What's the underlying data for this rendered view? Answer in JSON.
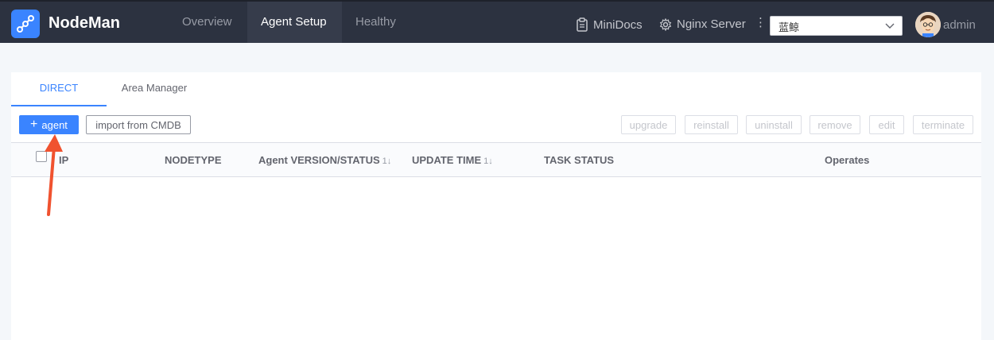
{
  "app": {
    "name": "NodeMan"
  },
  "nav": {
    "items": [
      {
        "label": "Overview"
      },
      {
        "label": "Agent Setup",
        "active": true
      },
      {
        "label": "Healthy"
      }
    ]
  },
  "header": {
    "minidocs": "MiniDocs",
    "server": "Nginx Server",
    "business_select": "蓝鲸",
    "user": "admin"
  },
  "tabs": [
    {
      "label": "DIRECT",
      "active": true
    },
    {
      "label": "Area Manager"
    }
  ],
  "toolbar": {
    "add_agent": "agent",
    "import_cmdb": "import from CMDB",
    "upgrade": "upgrade",
    "reinstall": "reinstall",
    "uninstall": "uninstall",
    "remove": "remove",
    "edit": "edit",
    "terminate": "terminate"
  },
  "table": {
    "columns": [
      "IP",
      "NODETYPE",
      "Agent VERSION/STATUS",
      "UPDATE TIME",
      "TASK STATUS",
      "Operates"
    ],
    "sort_glyph": "1↓"
  },
  "colors": {
    "topbar": "#2c3240",
    "accent": "#3a84ff",
    "annotation_arrow": "#f0522f"
  }
}
